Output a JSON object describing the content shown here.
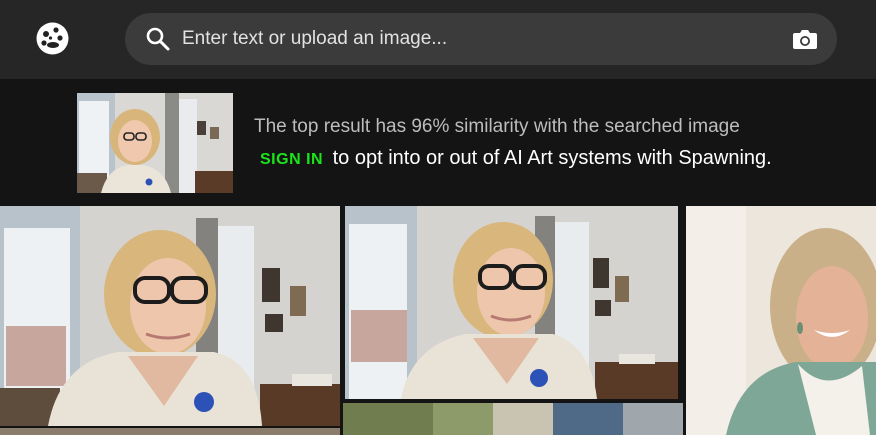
{
  "search": {
    "placeholder": "Enter text or upload an image..."
  },
  "banner": {
    "similarity_text": "The top result has 96% similarity with the searched image",
    "sign_in_label": "SIGN IN",
    "optin_text": "to opt into or out of AI Art systems with Spawning."
  },
  "colors": {
    "header_bg": "#262626",
    "search_bg": "#3b3b3b",
    "page_bg": "#141414",
    "sign_in_green": "#19e619"
  },
  "icons": [
    "logo-icon",
    "search-icon",
    "camera-icon"
  ]
}
